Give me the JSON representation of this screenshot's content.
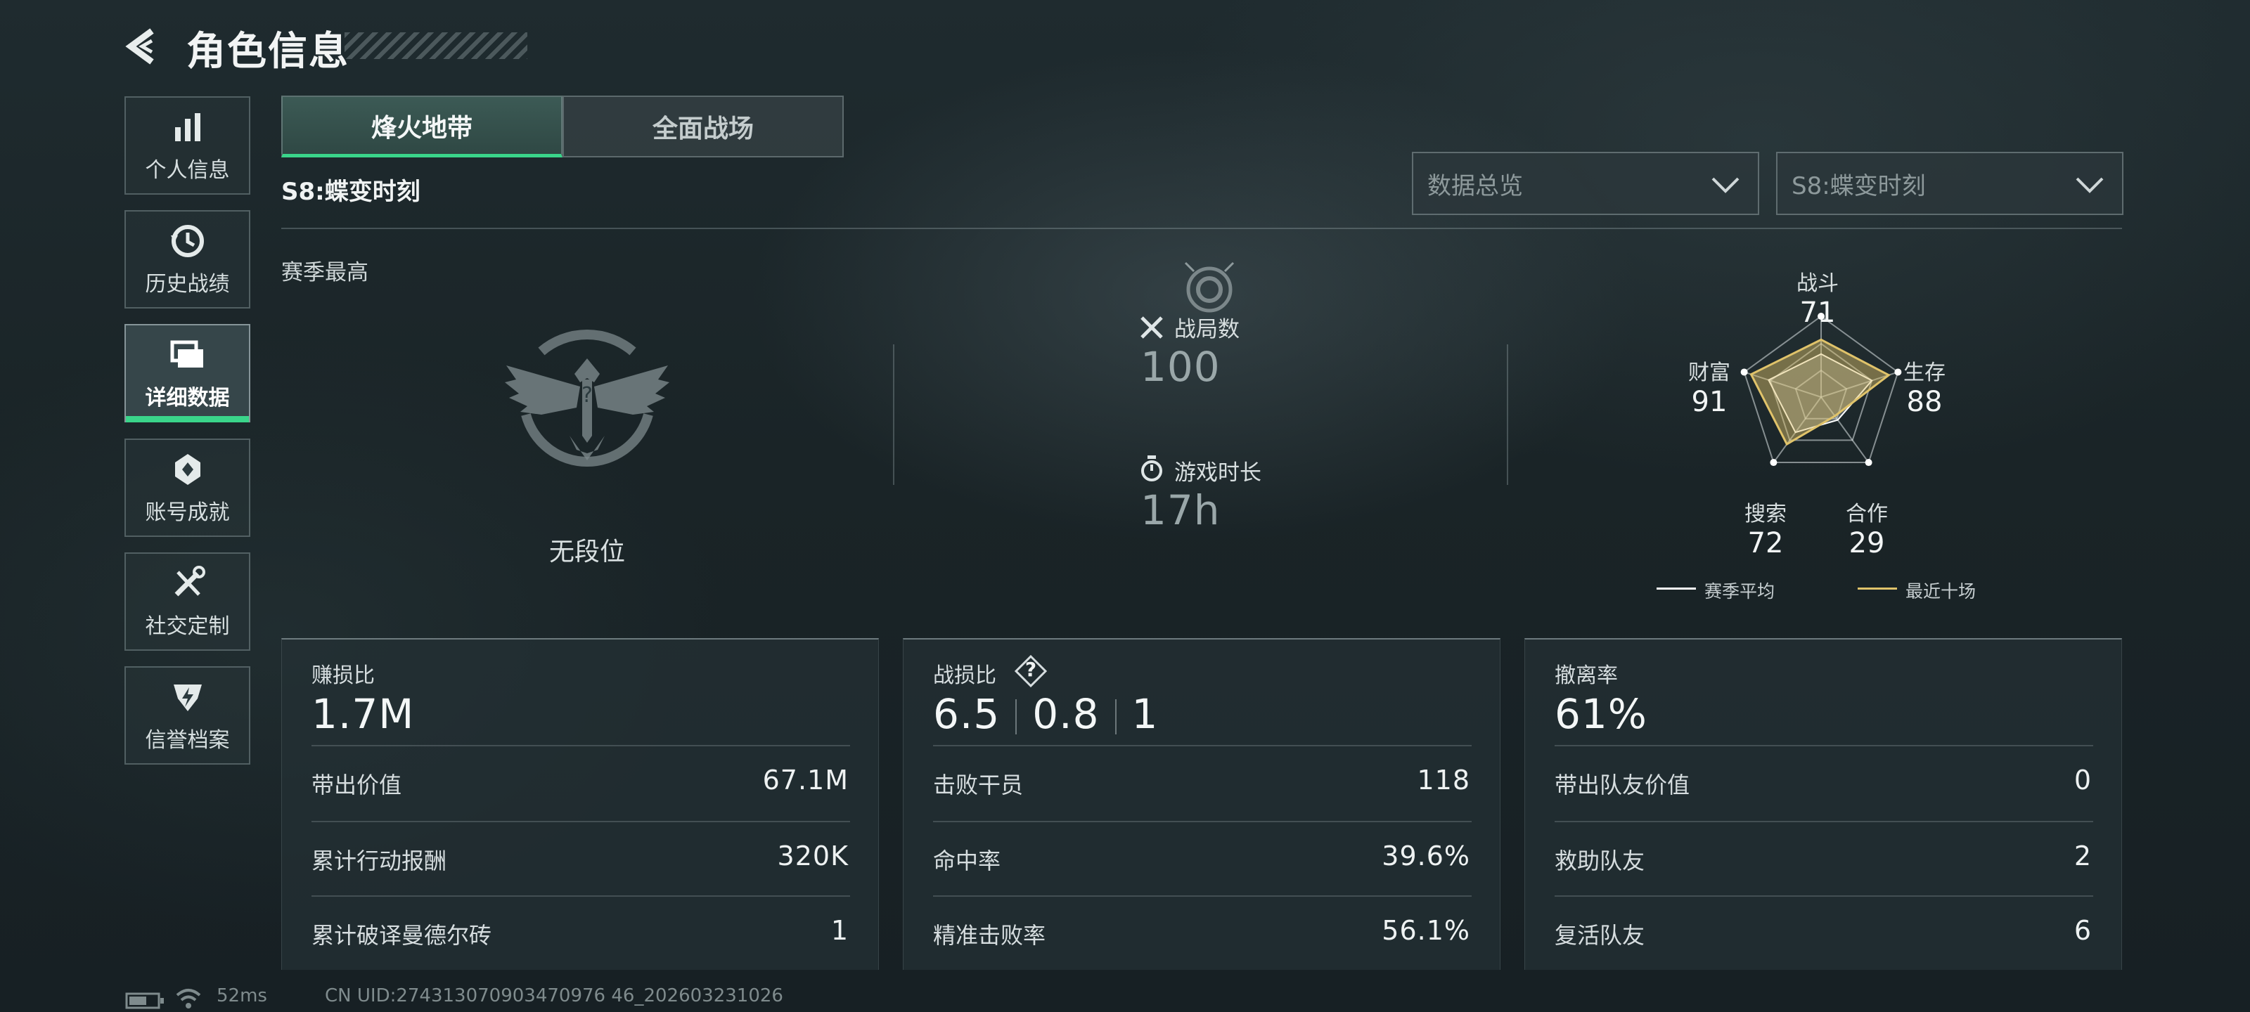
{
  "header": {
    "title": "角色信息"
  },
  "sidebar": {
    "items": [
      {
        "label": "个人信息",
        "icon": "bar-chart-icon"
      },
      {
        "label": "历史战绩",
        "icon": "history-clock-icon"
      },
      {
        "label": "详细数据",
        "icon": "folder-icon",
        "active": true
      },
      {
        "label": "账号成就",
        "icon": "achievement-badge-icon"
      },
      {
        "label": "社交定制",
        "icon": "wrench-screwdriver-icon"
      },
      {
        "label": "信誉档案",
        "icon": "shield-credit-icon"
      }
    ]
  },
  "tabs": [
    {
      "label": "烽火地带",
      "active": true
    },
    {
      "label": "全面战场",
      "active": false
    }
  ],
  "season_title": "S8:蝶变时刻",
  "filters": {
    "data_type": "数据总览",
    "season": "S8:蝶变时刻"
  },
  "overview": {
    "season_best_label": "赛季最高",
    "rank_label": "无段位",
    "matches_label": "战局数",
    "matches_value": "100",
    "playtime_label": "游戏时长",
    "playtime_value": "17h"
  },
  "radar": {
    "axes": [
      {
        "label": "战斗",
        "value": "71"
      },
      {
        "label": "生存",
        "value": "88"
      },
      {
        "label": "合作",
        "value": "29"
      },
      {
        "label": "搜索",
        "value": "72"
      },
      {
        "label": "财富",
        "value": "91"
      }
    ],
    "legend": [
      {
        "label": "赛季平均",
        "color": "#ffffff"
      },
      {
        "label": "最近十场",
        "color": "#e0c36a"
      }
    ]
  },
  "cards": {
    "profit": {
      "title": "赚损比",
      "big": "1.7M",
      "rows": [
        {
          "label": "带出价值",
          "value": "67.1M"
        },
        {
          "label": "累计行动报酬",
          "value": "320K"
        },
        {
          "label": "累计破译曼德尔砖",
          "value": "1"
        }
      ]
    },
    "kd": {
      "title": "战损比",
      "help": "?",
      "big": [
        "6.5",
        "0.8",
        "1"
      ],
      "rows": [
        {
          "label": "击败干员",
          "value": "118"
        },
        {
          "label": "命中率",
          "value": "39.6%"
        },
        {
          "label": "精准击败率",
          "value": "56.1%"
        }
      ]
    },
    "extract": {
      "title": "撤离率",
      "big": "61%",
      "rows": [
        {
          "label": "带出队友价值",
          "value": "0"
        },
        {
          "label": "救助队友",
          "value": "2"
        },
        {
          "label": "复活队友",
          "value": "6"
        }
      ]
    }
  },
  "footer": {
    "ping": "52ms",
    "uid": "CN UID:274313070903470976 46_202603231026"
  },
  "colors": {
    "accent": "#3ad58a",
    "recent_series": "#e0c36a"
  }
}
